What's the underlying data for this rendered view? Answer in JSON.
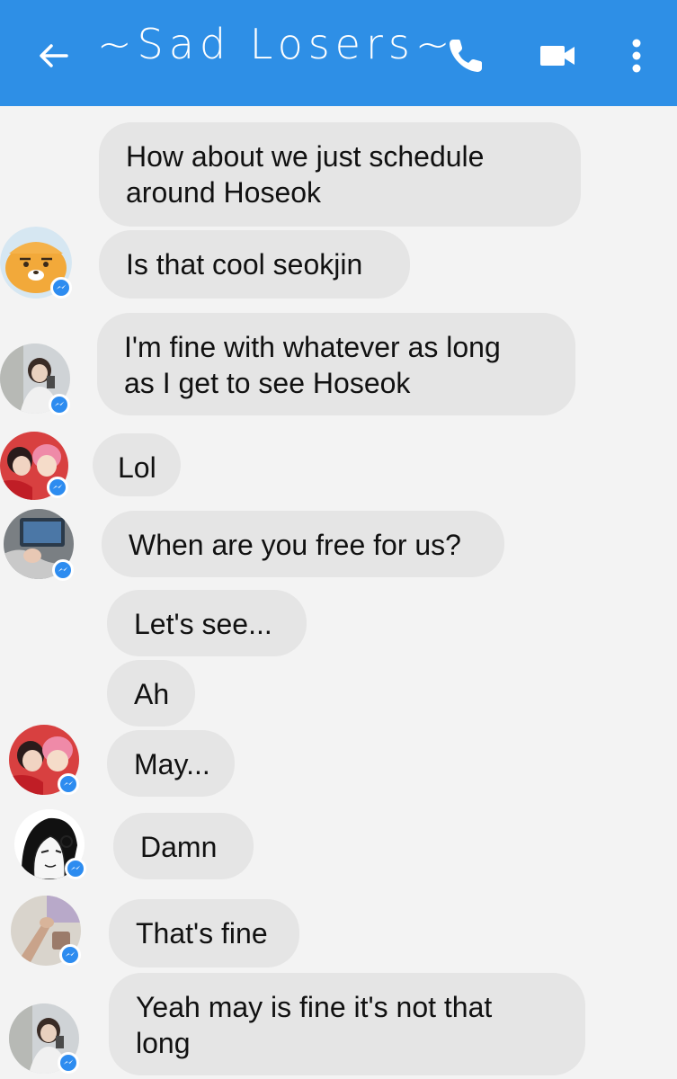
{
  "header": {
    "title": "~Sad Losers~",
    "back_icon": "arrow-back-icon",
    "call_icon": "phone-icon",
    "video_icon": "video-camera-icon",
    "more_icon": "more-vertical-icon",
    "bar_color": "#2e8fe6"
  },
  "messages": [
    {
      "text_lines": [
        "How about we just schedule",
        "around Hoseok"
      ],
      "avatar": null
    },
    {
      "text": "Is that cool seokjin",
      "avatar": "avatar-yellow-character"
    },
    {
      "text_lines": [
        "I'm fine with whatever as long",
        "as I get to see Hoseok"
      ],
      "avatar": "avatar-photo-mirror-selfie"
    },
    {
      "text": "Lol",
      "avatar": "avatar-photo-red-pink"
    },
    {
      "text": "When are you free for us?",
      "avatar": "avatar-photo-hand-screen"
    },
    {
      "text": "Let's see...",
      "avatar": null
    },
    {
      "text": "Ah",
      "avatar": null
    },
    {
      "text": "May...",
      "avatar": "avatar-photo-red-pink"
    },
    {
      "text": "Damn",
      "avatar": "avatar-comic-drawing"
    },
    {
      "text": "That's fine",
      "avatar": "avatar-photo-hand"
    },
    {
      "text_lines": [
        "Yeah may is fine it's not that",
        "long"
      ],
      "avatar": "avatar-photo-mirror-selfie"
    }
  ],
  "colors": {
    "bubble": "#e5e5e5",
    "background": "#f3f3f3",
    "messenger_badge": "#2d8cf0"
  }
}
